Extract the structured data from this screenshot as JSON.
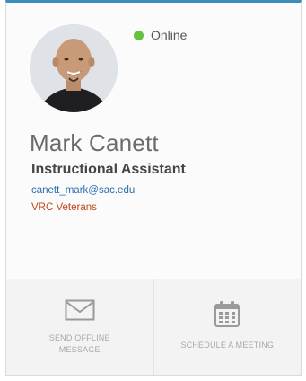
{
  "profile": {
    "status": "Online",
    "name": "Mark Canett",
    "title": "Instructional Assistant",
    "email": "canett_mark@sac.edu",
    "department": "VRC Veterans"
  },
  "actions": [
    {
      "icon": "envelope-icon",
      "label_line1": "SEND OFFLINE",
      "label_line2": "MESSAGE"
    },
    {
      "icon": "calendar-icon",
      "label_line1": "SCHEDULE A MEETING",
      "label_line2": ""
    }
  ],
  "colors": {
    "accent": "#3c8dbc",
    "online": "#62c23e",
    "email": "#2a6db0",
    "department": "#c0451c"
  }
}
